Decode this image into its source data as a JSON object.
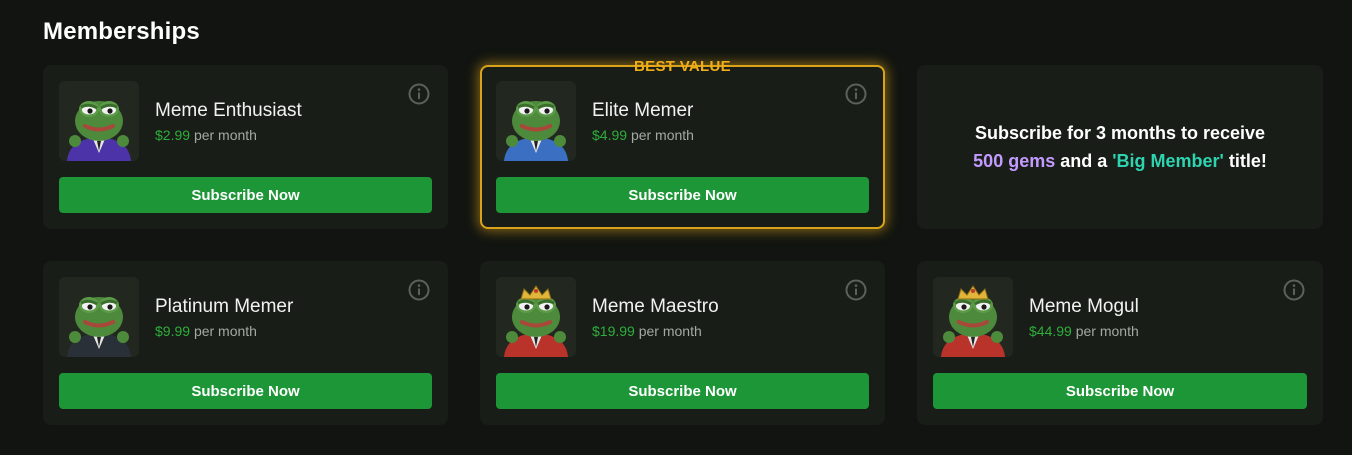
{
  "page": {
    "title": "Memberships"
  },
  "cards": [
    {
      "name": "Meme Enthusiast",
      "price": "$2.99",
      "period": "per month",
      "button": "Subscribe Now",
      "suit_color": "#4c34a8",
      "crown": false
    },
    {
      "name": "Elite Memer",
      "price": "$4.99",
      "period": "per month",
      "button": "Subscribe Now",
      "badge": "BEST VALUE",
      "suit_color": "#3a6fc2",
      "crown": false
    },
    {
      "name": "Platinum Memer",
      "price": "$9.99",
      "period": "per month",
      "button": "Subscribe Now",
      "suit_color": "#2a3038",
      "crown": false
    },
    {
      "name": "Meme Maestro",
      "price": "$19.99",
      "period": "per month",
      "button": "Subscribe Now",
      "suit_color": "#b9332a",
      "crown": true
    },
    {
      "name": "Meme Mogul",
      "price": "$44.99",
      "period": "per month",
      "button": "Subscribe Now",
      "suit_color": "#b9332a",
      "crown": true
    }
  ],
  "promo": {
    "line1": "Subscribe for 3 months to receive",
    "gems": "500 gems",
    "middle": " and a ",
    "title_name": "'Big Member'",
    "end": " title!"
  },
  "colors": {
    "accent_green": "#1c9636",
    "price_green": "#2fae3c",
    "best_value": "#f0ad18",
    "gems": "#c39bff",
    "big_member": "#2ed3b0"
  },
  "icons": {
    "info": "info-icon",
    "avatar": "frog-avatar"
  }
}
